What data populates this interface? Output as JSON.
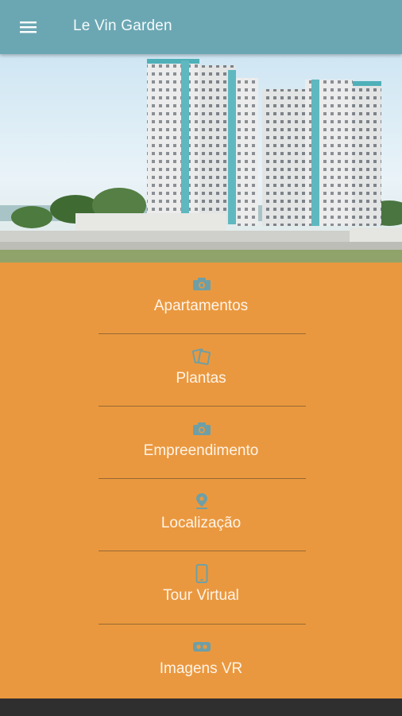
{
  "app": {
    "title": "Le Vin Garden",
    "menu_icon": "hamburger-menu-icon"
  },
  "hero": {
    "image_alt": "building-render"
  },
  "menu": {
    "items": [
      {
        "label": "Apartamentos",
        "icon": "camera-icon"
      },
      {
        "label": "Plantas",
        "icon": "pages-icon"
      },
      {
        "label": "Empreendimento",
        "icon": "camera-icon"
      },
      {
        "label": "Localização",
        "icon": "map-pin-icon"
      },
      {
        "label": "Tour Virtual",
        "icon": "smartphone-icon"
      },
      {
        "label": "Imagens VR",
        "icon": "vr-headset-icon"
      }
    ]
  },
  "colors": {
    "appbar": "#6ba7b3",
    "menu_bg": "#ea983f",
    "icon": "#6f9fa6",
    "label": "#fff4e8"
  }
}
